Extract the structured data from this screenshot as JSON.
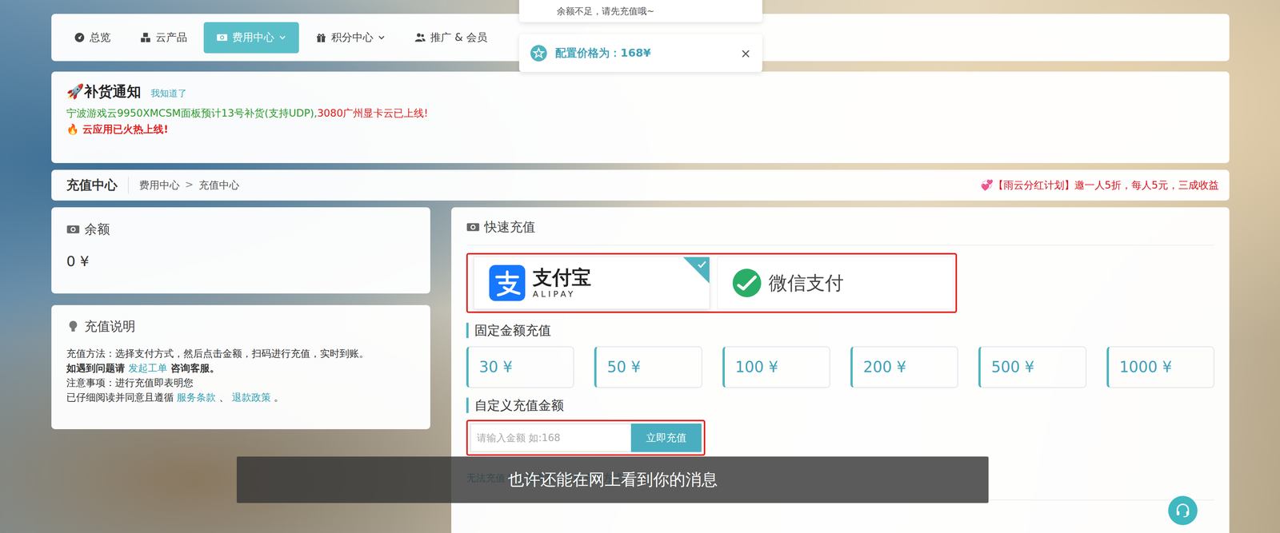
{
  "toasts": [
    {
      "text": "余额不足，请先充值哦~",
      "kind": "plain"
    },
    {
      "text": "配置价格为：168¥",
      "kind": "info",
      "close": "×"
    }
  ],
  "nav": [
    {
      "label": "总览",
      "selected": false,
      "dropdown": false,
      "icon": "gauge"
    },
    {
      "label": "云产品",
      "selected": false,
      "dropdown": false,
      "icon": "cubes"
    },
    {
      "label": "费用中心",
      "selected": true,
      "dropdown": true,
      "icon": "money"
    },
    {
      "label": "积分中心",
      "selected": false,
      "dropdown": true,
      "icon": "gift"
    },
    {
      "label": "推广 & 会员",
      "selected": false,
      "dropdown": false,
      "icon": "users"
    }
  ],
  "notice": {
    "title": "🚀补货通知",
    "dismiss": "我知道了",
    "lines": [
      [
        {
          "text": "宁波游戏云9950XMCSM面板预计13号补货(支持UDP),",
          "color": "#2f9a2f",
          "bold": false
        },
        {
          "text": "3080广州显卡云已上线!",
          "color": "#e0201c",
          "bold": false
        }
      ],
      [
        {
          "text": "🔥 云应用已火热上线!",
          "color": "#e0201c",
          "bold": true
        }
      ]
    ]
  },
  "breadcrumb": {
    "title": "充值中心",
    "path": [
      "费用中心",
      "充值中心"
    ],
    "separator": ">",
    "promo": "💞【雨云分红计划】邀一人5折，每人5元，三成收益"
  },
  "balance": {
    "title": "余额",
    "value": "0 ¥"
  },
  "instructions": {
    "title": "充值说明",
    "lines": [
      [
        {
          "text": "充值方法：选择支付方式，然后点击金额，扫码进行充值，实时到账。",
          "kind": "text"
        }
      ],
      [
        {
          "text": "如遇到问题请 ",
          "kind": "bold"
        },
        {
          "text": "发起工单",
          "kind": "link"
        },
        {
          "text": " 咨询客服。",
          "kind": "bold"
        }
      ],
      [
        {
          "text": "注意事项：进行充值即表明您",
          "kind": "text"
        }
      ],
      [
        {
          "text": "已仔细阅读并同意且遵循 ",
          "kind": "text"
        },
        {
          "text": "服务条款",
          "kind": "link"
        },
        {
          "text": " 、 ",
          "kind": "text"
        },
        {
          "text": "退款政策",
          "kind": "link"
        },
        {
          "text": " 。",
          "kind": "text"
        }
      ]
    ]
  },
  "recharge": {
    "title": "快速充值",
    "methods_highlighted": true,
    "methods": [
      {
        "name": "支付宝",
        "sub": "ALIPAY",
        "kind": "alipay",
        "selected": true
      },
      {
        "name": "微信支付",
        "kind": "wechat",
        "selected": false
      }
    ],
    "fixed_title": "固定金额充值",
    "amounts": [
      "30 ¥",
      "50 ¥",
      "100 ¥",
      "200 ¥",
      "500 ¥",
      "1000 ¥"
    ],
    "custom_title": "自定义充值金额",
    "custom_highlighted": true,
    "input_placeholder": "请输入金额 如:168",
    "submit": "立即充值",
    "alt_link": "无法充值？点击查看【其他充值方式】"
  },
  "subtitle": "也许还能在网上看到你的消息"
}
